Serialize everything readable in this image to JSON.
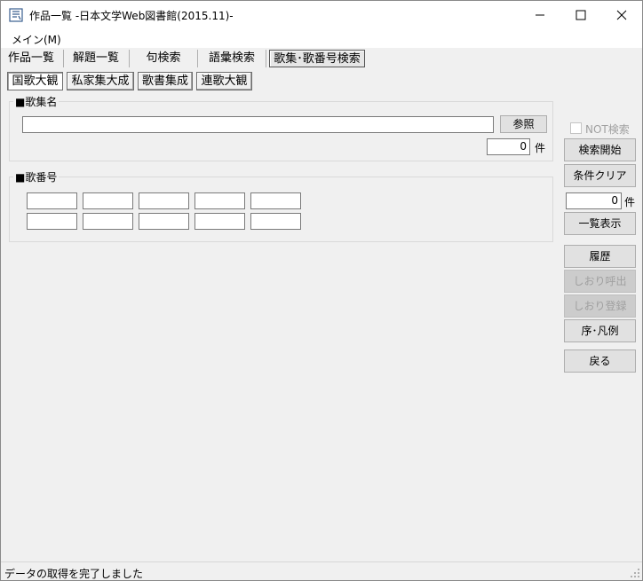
{
  "window": {
    "title": "作品一覧 -日本文学Web図書館(2015.11)-",
    "icon": "book-app-icon"
  },
  "menu": {
    "main_label": "メイン(M)"
  },
  "tabs": [
    {
      "label": "作品一覧",
      "active": false
    },
    {
      "label": "解題一覧",
      "active": false
    },
    {
      "label": "句検索",
      "active": false
    },
    {
      "label": "語彙検索",
      "active": false
    },
    {
      "label": "歌集･歌番号検索",
      "active": true
    }
  ],
  "subtabs": [
    {
      "label": "国歌大観",
      "active": true
    },
    {
      "label": "私家集大成",
      "active": false
    },
    {
      "label": "歌書集成",
      "active": false
    },
    {
      "label": "連歌大観",
      "active": false
    }
  ],
  "kashu": {
    "group_title": "■歌集名",
    "name_value": "",
    "browse_label": "参照",
    "count_value": "0",
    "count_unit": "件"
  },
  "kaban": {
    "group_title": "■歌番号",
    "fields": [
      "",
      "",
      "",
      "",
      "",
      "",
      "",
      "",
      "",
      ""
    ]
  },
  "right_panel": {
    "not_search_label": "NOT検索",
    "not_search_checked": false,
    "search_start": "検索開始",
    "clear_conditions": "条件クリア",
    "result_count": "0",
    "result_unit": "件",
    "list_view": "一覧表示",
    "history": "履歴",
    "bookmark_open": "しおり呼出",
    "bookmark_save": "しおり登録",
    "preface": "序･凡例",
    "back": "戻る"
  },
  "status": {
    "text": "データの取得を完了しました"
  }
}
